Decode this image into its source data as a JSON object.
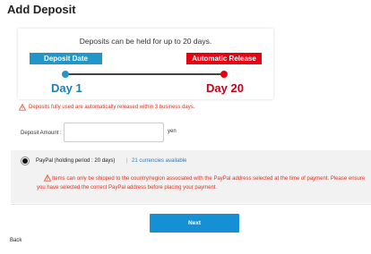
{
  "page": {
    "title": "Add Deposit"
  },
  "info_box": {
    "hold_text": "Deposits can be held for up to 20 days.",
    "start_tag": "Deposit Date",
    "end_tag": "Automatic Release",
    "start_day": "Day 1",
    "end_day": "Day 20"
  },
  "notice": {
    "text": "Deposits fully used are automatically released within 3 business days."
  },
  "amount": {
    "label": "Deposit Amount :",
    "value": "",
    "unit": "yen"
  },
  "payment": {
    "method_label": "PayPal (holding period : 20 days)",
    "separator": "|",
    "currencies_link": "21 currencies available",
    "warning": "Items can only be shipped to the country/region associated with the PayPal address selected at the time of payment. Please ensure you have selected the correct PayPal address before placing your payment."
  },
  "actions": {
    "next_label": "Next",
    "back_label": "Back"
  },
  "colors": {
    "accent_blue": "#1590d4",
    "timeline_blue": "#2196c9",
    "alert_red": "#e60012",
    "warning_text": "#e0301e"
  },
  "icons": {
    "warning": "warning-triangle-icon",
    "radio": "radio-selected"
  }
}
